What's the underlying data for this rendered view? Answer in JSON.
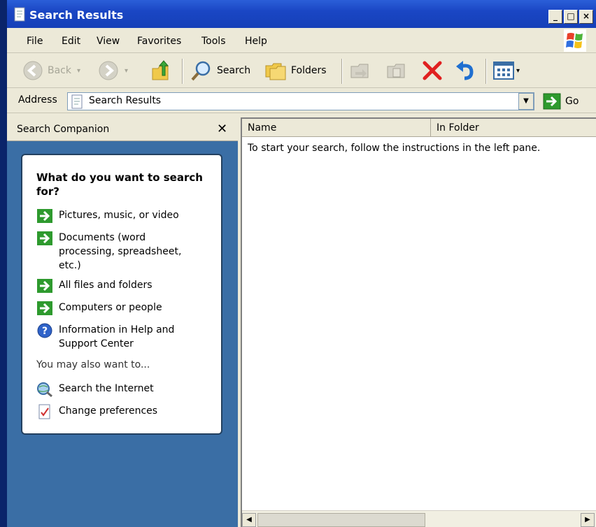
{
  "window": {
    "title": "Search Results"
  },
  "menu": [
    "File",
    "Edit",
    "View",
    "Favorites",
    "Tools",
    "Help"
  ],
  "toolbar": {
    "back": "Back",
    "search": "Search",
    "folders": "Folders"
  },
  "address": {
    "label": "Address",
    "value": "Search Results",
    "go": "Go"
  },
  "left_pane": {
    "title": "Search Companion",
    "question": "What do you want to search for?",
    "options": [
      {
        "icon": "green-arrow-icon",
        "label": "Pictures, music, or video"
      },
      {
        "icon": "green-arrow-icon",
        "label": "Documents (word processing, spreadsheet, etc.)"
      },
      {
        "icon": "green-arrow-icon",
        "label": "All files and folders"
      },
      {
        "icon": "green-arrow-icon",
        "label": "Computers or people"
      },
      {
        "icon": "help-icon",
        "label": "Information in Help and Support Center"
      }
    ],
    "also_label": "You may also want to...",
    "also_options": [
      {
        "icon": "search-internet-icon",
        "label": "Search the Internet"
      },
      {
        "icon": "preferences-icon",
        "label": "Change preferences"
      }
    ]
  },
  "results": {
    "columns": [
      "Name",
      "In Folder"
    ],
    "hint": "To start your search, follow the instructions in the left pane."
  },
  "colors": {
    "title_bar": "#1a46c4",
    "pane_blue": "#3a6ea5",
    "go_green": "#2e9a2e"
  }
}
